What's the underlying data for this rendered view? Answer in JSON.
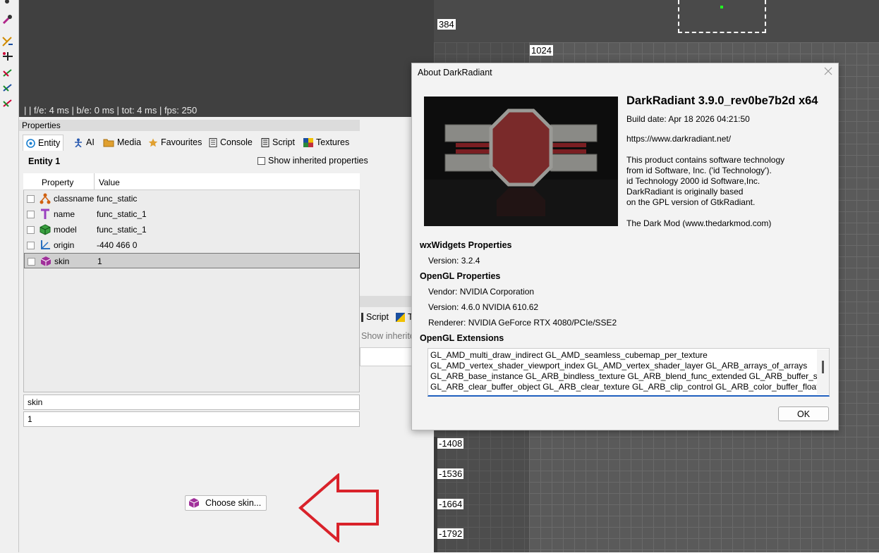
{
  "camera": {
    "stats": "|  | f/e: 4 ms | b/e: 0 ms | tot: 4 ms | fps: 250"
  },
  "ortho": {
    "coords_top": [
      "384"
    ],
    "coord_1024": "1024",
    "coords_bottom": [
      "-1408",
      "-1536",
      "-1664",
      "-1792"
    ]
  },
  "properties": {
    "title": "Properties",
    "tabs": [
      {
        "label": "Entity",
        "icon": "entity-icon"
      },
      {
        "label": "AI",
        "icon": "ai-icon"
      },
      {
        "label": "Media",
        "icon": "folder-icon"
      },
      {
        "label": "Favourites",
        "icon": "star-icon"
      },
      {
        "label": "Console",
        "icon": "console-icon"
      },
      {
        "label": "Script",
        "icon": "script-icon"
      },
      {
        "label": "Textures",
        "icon": "textures-icon"
      }
    ],
    "entity_name": "Entity 1",
    "show_inherited": "Show inherited properties",
    "columns": [
      "Property",
      "Value"
    ],
    "rows": [
      {
        "key": "classname",
        "value": "func_static",
        "icon": "classname-icon"
      },
      {
        "key": "name",
        "value": "func_static_1",
        "icon": "text-icon"
      },
      {
        "key": "model",
        "value": "func_static_1",
        "icon": "model-cube-icon"
      },
      {
        "key": "origin",
        "value": "-440 466 0",
        "icon": "origin-axes-icon"
      },
      {
        "key": "skin",
        "value": "1",
        "icon": "skin-icon"
      }
    ],
    "key_field": "skin",
    "value_field": "1",
    "choose_skin": "Choose skin..."
  },
  "ghost": {
    "script": "Script",
    "textures_short": "T",
    "show_inherited": "Show inherite"
  },
  "about": {
    "title": "About DarkRadiant",
    "product": "DarkRadiant 3.9.0_rev0be7b2d x64",
    "build_date": "Build date: Apr 18 2026 04:21:50",
    "url": "https://www.darkradiant.net/",
    "notice": [
      "This product contains software technology",
      "from id Software, Inc. ('id Technology').",
      "id Technology 2000 id Software,Inc.",
      "DarkRadiant is originally based",
      "on the GPL version of GtkRadiant."
    ],
    "darkmod": "The Dark Mod (www.thedarkmod.com)",
    "wx_header": "wxWidgets Properties",
    "wx_version": "Version: 3.2.4",
    "gl_header": "OpenGL Properties",
    "gl_vendor": "Vendor: NVIDIA Corporation",
    "gl_version": "Version: 4.6.0 NVIDIA 610.62",
    "gl_renderer": "Renderer: NVIDIA GeForce RTX 4080/PCIe/SSE2",
    "ext_header": "OpenGL Extensions",
    "extensions": "GL_AMD_multi_draw_indirect GL_AMD_seamless_cubemap_per_texture\nGL_AMD_vertex_shader_viewport_index GL_AMD_vertex_shader_layer GL_ARB_arrays_of_arrays\nGL_ARB_base_instance GL_ARB_bindless_texture GL_ARB_blend_func_extended GL_ARB_buffer_storage\nGL_ARB_clear_buffer_object GL_ARB_clear_texture GL_ARB_clip_control GL_ARB_color_buffer_float",
    "ok": "OK"
  },
  "colors": {
    "annotation_arrow": "#d9222a",
    "dialog_accent": "#1f5fbf"
  }
}
